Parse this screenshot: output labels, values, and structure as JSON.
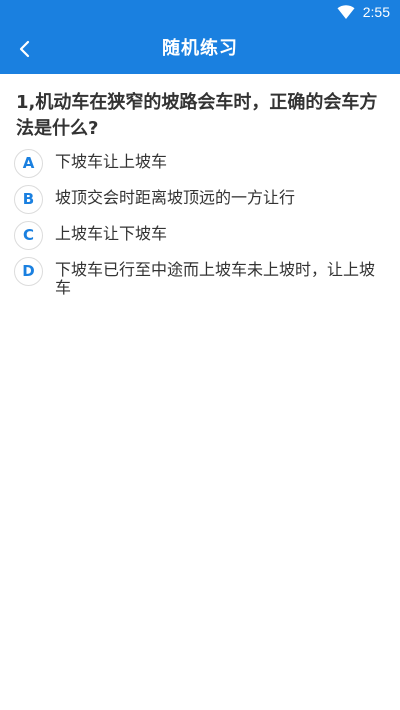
{
  "status_bar": {
    "time": "2:55",
    "wifi_icon": "wifi-icon"
  },
  "header": {
    "title": "随机练习",
    "back_icon": "chevron-left-icon",
    "background": "#1a80e0"
  },
  "question": {
    "text": "1,机动车在狭窄的坡路会车时，正确的会车方法是什么?"
  },
  "options": [
    {
      "letter": "A",
      "text": "下坡车让上坡车"
    },
    {
      "letter": "B",
      "text": "坡顶交会时距离坡顶远的一方让行"
    },
    {
      "letter": "C",
      "text": "上坡车让下坡车"
    },
    {
      "letter": "D",
      "text": "下坡车已行至中途而上坡车未上坡时，让上坡车"
    }
  ],
  "colors": {
    "accent": "#1a80e0",
    "text": "#333333",
    "badge_border": "#dcdcdc"
  }
}
